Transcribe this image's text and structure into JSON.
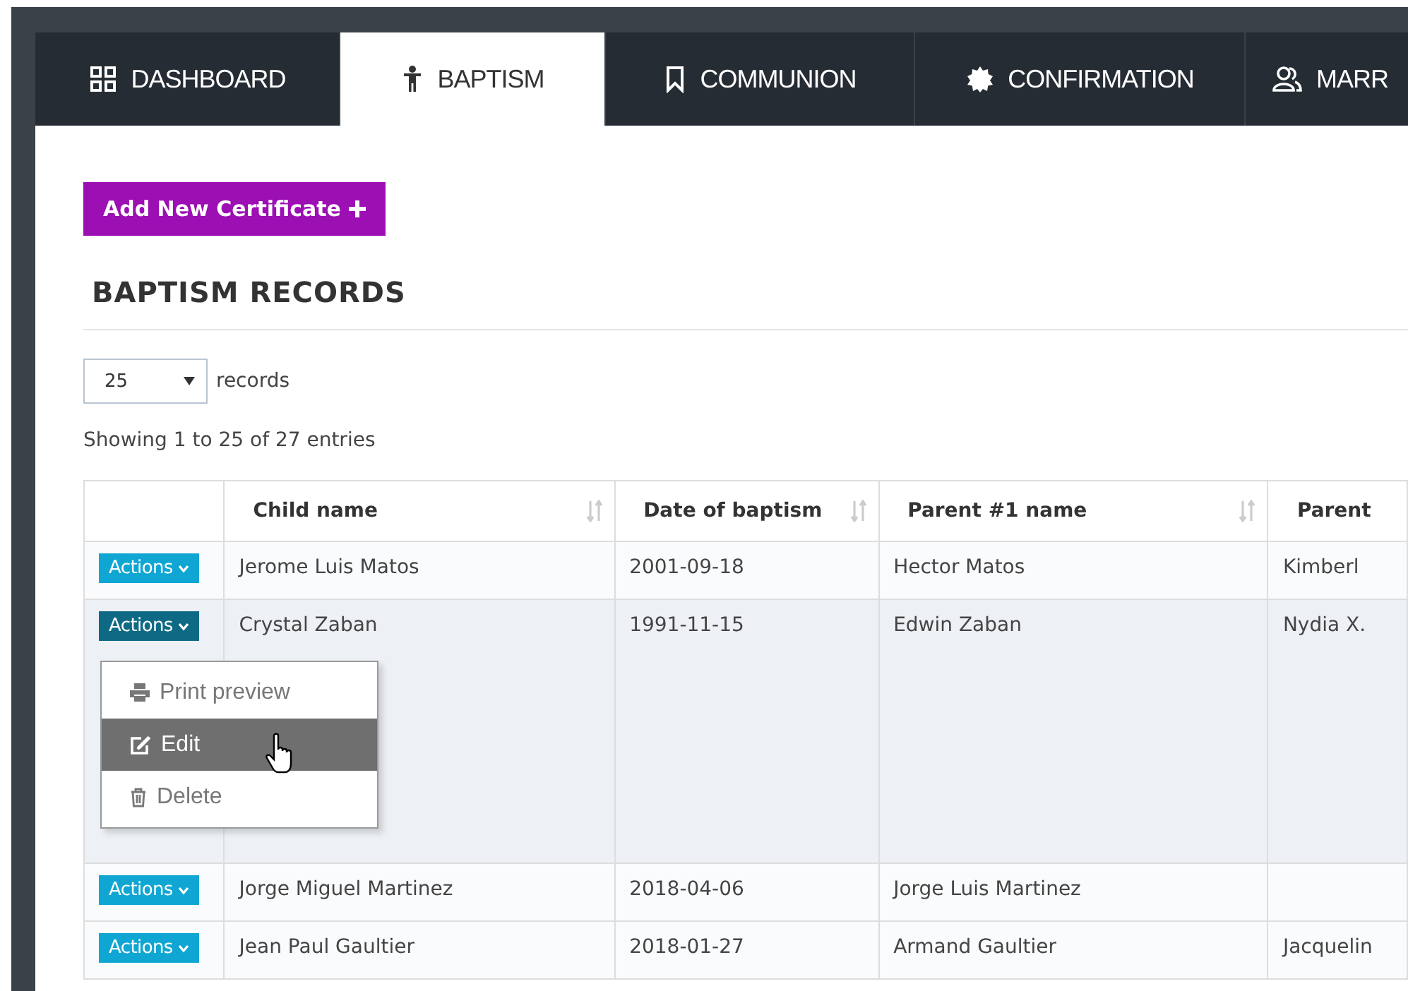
{
  "tabs": [
    {
      "label": "DASHBOARD",
      "selected": false
    },
    {
      "label": "BAPTISM",
      "selected": true
    },
    {
      "label": "COMMUNION",
      "selected": false
    },
    {
      "label": "CONFIRMATION",
      "selected": false
    },
    {
      "label": "MARR",
      "selected": false
    }
  ],
  "add_button": "Add New Certificate",
  "heading": "BAPTISM RECORDS",
  "page_size": {
    "value": "25",
    "label": "records"
  },
  "info": "Showing 1 to 25 of 27 entries",
  "table": {
    "columns": [
      "Child name",
      "Date of baptism",
      "Parent #1 name",
      "Parent"
    ],
    "rows": [
      {
        "actions": "Actions",
        "menu_open": false,
        "cells": [
          "Jerome Luis Matos",
          "2001-09-18",
          "Hector Matos",
          "Kimberl"
        ]
      },
      {
        "actions": "Actions",
        "menu_open": true,
        "cells": [
          "Crystal Zaban",
          "1991-11-15",
          "Edwin Zaban",
          "Nydia X."
        ]
      },
      {
        "actions": "Actions",
        "menu_open": false,
        "cells": [
          "Jorge Miguel Martinez",
          "2018-04-06",
          "Jorge Luis Martinez",
          ""
        ]
      },
      {
        "actions": "Actions",
        "menu_open": false,
        "cells": [
          "Jean Paul Gaultier",
          "2018-01-27",
          "Armand Gaultier",
          "Jacquelin"
        ]
      }
    ]
  },
  "actions_menu": [
    {
      "label": "Print preview",
      "selected": false
    },
    {
      "label": "Edit",
      "selected": true
    },
    {
      "label": "Delete",
      "selected": false
    }
  ]
}
